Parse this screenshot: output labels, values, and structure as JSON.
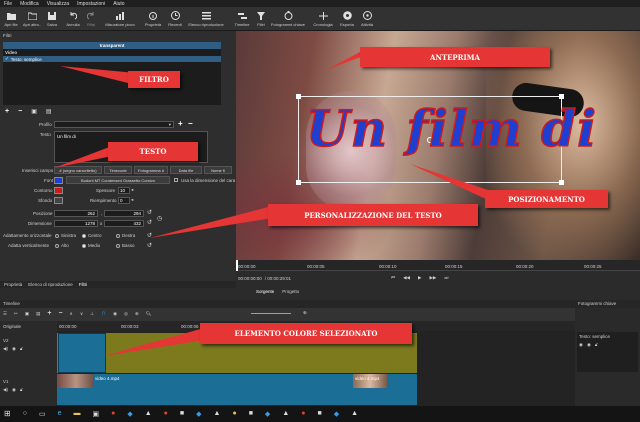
{
  "menu": [
    "File",
    "Modifica",
    "Visualizza",
    "Impostazioni",
    "Aiuto"
  ],
  "toolbar": [
    {
      "label": "Apri file",
      "icon": "folder-icon"
    },
    {
      "label": "Apri altro..",
      "icon": "open-other-icon"
    },
    {
      "label": "Salva",
      "icon": "save-icon"
    },
    {
      "label": "Annulla",
      "icon": "undo-icon"
    },
    {
      "label": "Rifai",
      "icon": "redo-icon"
    },
    {
      "label": "Misuratore picco",
      "icon": "peak-meter-icon"
    },
    {
      "label": "Proprietà",
      "icon": "properties-icon"
    },
    {
      "label": "Recenti",
      "icon": "recent-icon"
    },
    {
      "label": "Elenco riproduzione",
      "icon": "playlist-icon"
    },
    {
      "label": "Timeline",
      "icon": "timeline-icon"
    },
    {
      "label": "Filtri",
      "icon": "filter-icon"
    },
    {
      "label": "Fotogrammi chiave",
      "icon": "keyframes-icon"
    },
    {
      "label": "Cronologia",
      "icon": "history-icon"
    },
    {
      "label": "Esporta",
      "icon": "export-icon"
    },
    {
      "label": "Attività",
      "icon": "jobs-icon"
    }
  ],
  "filters": {
    "panel_title": "Filtri",
    "header": "transparent",
    "section": "Video",
    "item": "Testo: semplice"
  },
  "text_filter": {
    "profile_label": "Profilo",
    "text_label": "Testo",
    "text_value": "Un film di",
    "insert_field_label": "Inserisci campo",
    "insert_buttons": [
      "# (segno cancelletto)",
      "Timecode",
      "Fotogramma #",
      "Data file",
      "Nome fi"
    ],
    "font_label": "Font",
    "font_value": "Bodoni MT Condensed Grassetto Corsivo",
    "use_size_label": "Usa la dimensione del cara",
    "outline_label": "Contorno",
    "thickness_label": "Spessore",
    "thickness_value": "10",
    "background_label": "Sfondo",
    "padding_label": "Riempimento",
    "padding_value": "0",
    "position_label": "Posizione",
    "position_x": "262",
    "position_y": "294",
    "size_label": "Dimensione",
    "size_w": "1278",
    "size_h": "432",
    "h_align_label": "Adattamento orizzontale",
    "h_align_options": [
      "Sinistra",
      "Centro",
      "Destra"
    ],
    "v_align_label": "Adatta verticalmente",
    "v_align_options": [
      "Alto",
      "Medio",
      "Basso"
    ]
  },
  "colors": {
    "font_color": "#1e3fd0",
    "outline_color": "#cc1b1b",
    "callout": "#e53535",
    "video_track": "#1b6f97",
    "color_track": "#7d7a1e"
  },
  "preview": {
    "overlay_text": "Un film di"
  },
  "player": {
    "ticks": [
      "00:00:00",
      "00:00:05",
      "00:00:10",
      "00:00:15",
      "00:00:20",
      "00:00:25"
    ],
    "tabs": [
      "Sorgente",
      "Progetto"
    ],
    "timecode": "00:00:00:00",
    "duration": "/ 00:00:29:01"
  },
  "left_tabs": [
    "Proprietà",
    "Elenco di riproduzione",
    "Filtri"
  ],
  "timeline": {
    "title": "Timeline",
    "keyframes_title": "Fotogrammi chiave",
    "ruler": [
      "00:00:00",
      "00:00:03",
      "00:00:06"
    ],
    "track_labels": [
      "Originale",
      "V2",
      "V1"
    ],
    "clip_label": "video 4.mp4",
    "clip_label_right": "video 4.mp4",
    "keyframe_filter": "Testo: semplice"
  },
  "callouts": {
    "anteprima": "ANTEPRIMA",
    "filtro": "FILTRO",
    "testo": "TESTO",
    "posizionamento": "POSIZIONAMENTO",
    "personalizzazione": "PERSONALIZZAZIONE DEL TESTO",
    "elemento": "ELEMENTO COLORE SELEZIONATO"
  }
}
